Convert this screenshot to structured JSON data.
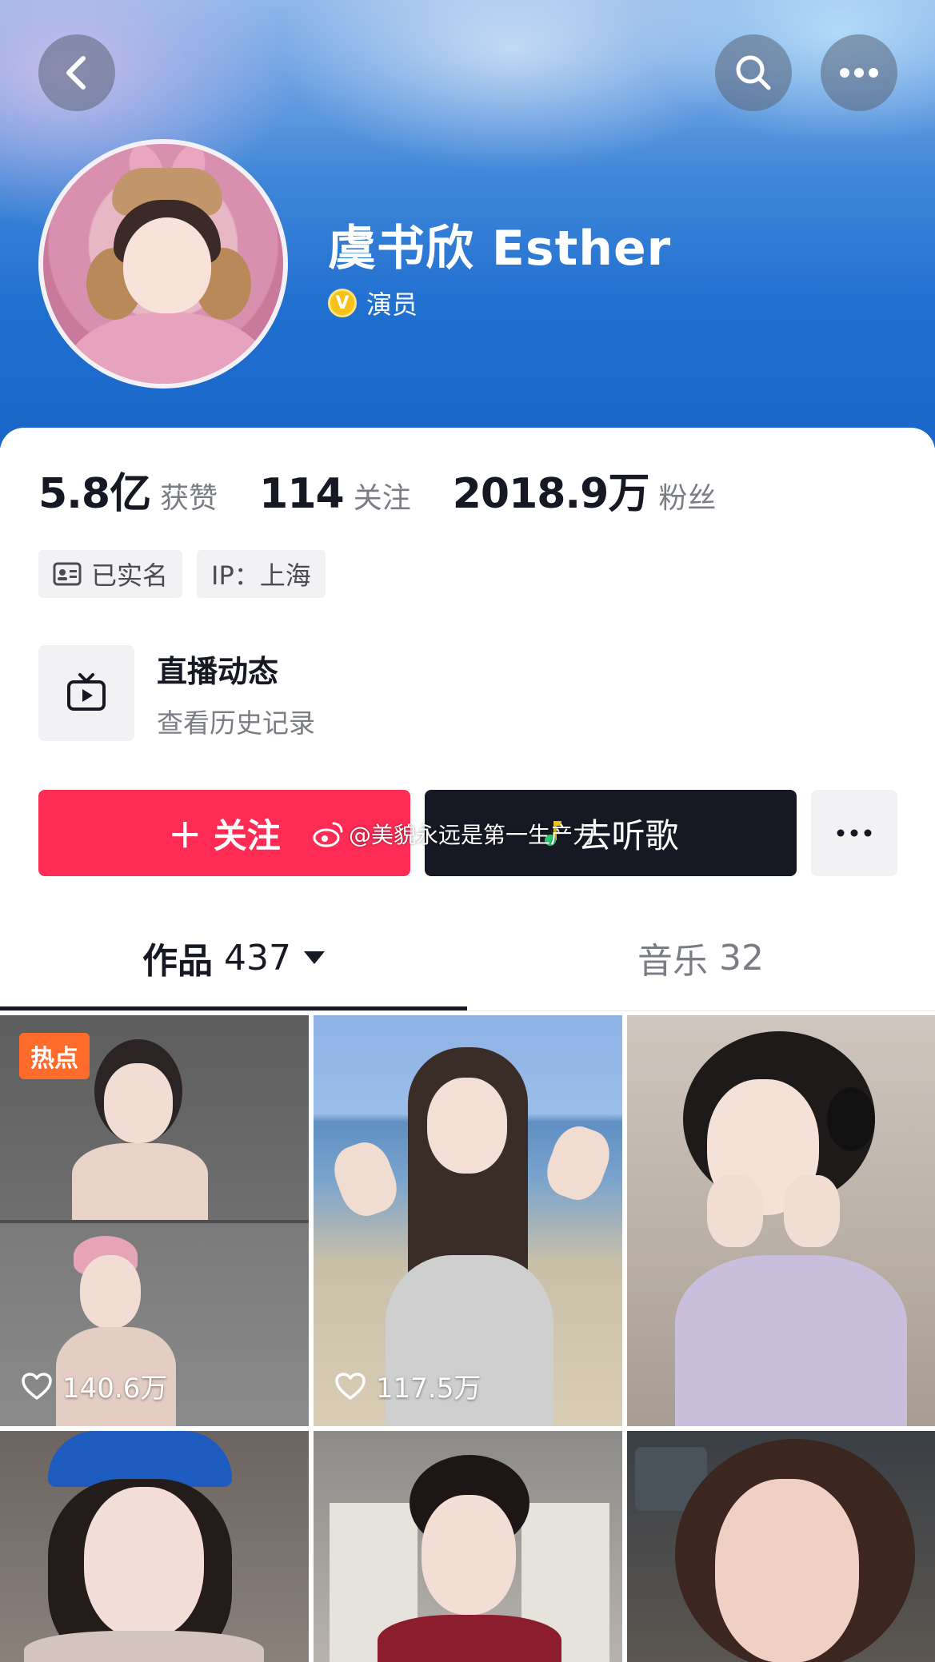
{
  "profile": {
    "name": "虞书欣 Esther",
    "verification": "演员"
  },
  "stats": [
    {
      "value": "5.8亿",
      "label": "获赞"
    },
    {
      "value": "114",
      "label": "关注"
    },
    {
      "value": "2018.9万",
      "label": "粉丝"
    }
  ],
  "tags": {
    "verified": "已实名",
    "ip": "IP：上海"
  },
  "live": {
    "title": "直播动态",
    "subtitle": "查看历史记录"
  },
  "actions": {
    "follow": "＋ 关注",
    "listen": "去听歌"
  },
  "watermark": "@美貌永远是第一生产力",
  "tabs": {
    "works_label": "作品",
    "works_count": "437",
    "music_label": "音乐",
    "music_count": "32"
  },
  "videos": [
    {
      "badge": "热点",
      "likes": "140.6万"
    },
    {
      "likes": "117.5万"
    }
  ],
  "colors": {
    "follow": "#fe2c55",
    "listen": "#161823",
    "hot_badge": "#ff6b2b",
    "verify": "#f5c318"
  }
}
